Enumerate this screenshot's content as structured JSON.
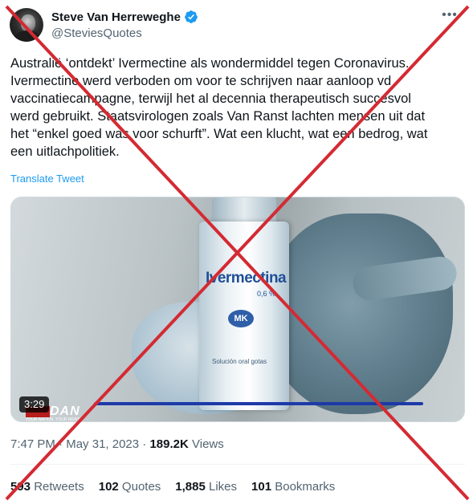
{
  "author": {
    "display_name": "Steve Van Herreweghe",
    "handle": "@SteviesQuotes",
    "verified_icon": "verified-badge-icon",
    "verified_color": "#1d9bf0"
  },
  "more_icon": "more-icon",
  "tweet": {
    "lines": [
      "Australië ‘ontdekt’ Ivermectine als wondermiddel tegen Coronavirus.",
      "Ivermectine werd verboden om voor te schrijven naar aanloop vd",
      "vaccinatiecampagne, terwijl het al decennia therapeutisch succesvol",
      "werd gebruikt. Staatsvirologen zoals Van Ranst lachten mensen uit dat",
      "het “enkel goed was voor schurft”. Wat een klucht, wat een bedrog, wat",
      "een uitlachpolitiek."
    ],
    "translate_label": "Translate Tweet"
  },
  "media": {
    "product_name": "Ivermectina",
    "concentration": "0,6 %",
    "logo_text": "MK",
    "subtext": "Solución oral gotas",
    "brand": "DAN",
    "brand_tagline": "YOUR NATION. YOUR NEWS.",
    "duration": "3:29",
    "progress_color": "#1d3aa8"
  },
  "meta": {
    "time": "7:47 PM",
    "separator": " · ",
    "date": "May 31, 2023",
    "views_count": "189.2K",
    "views_label": " Views"
  },
  "stats": [
    {
      "count": "593",
      "label": " Retweets"
    },
    {
      "count": "102",
      "label": " Quotes"
    },
    {
      "count": "1,885",
      "label": " Likes"
    },
    {
      "count": "101",
      "label": " Bookmarks"
    }
  ],
  "overlay": {
    "cross_color": "#d42a33"
  }
}
